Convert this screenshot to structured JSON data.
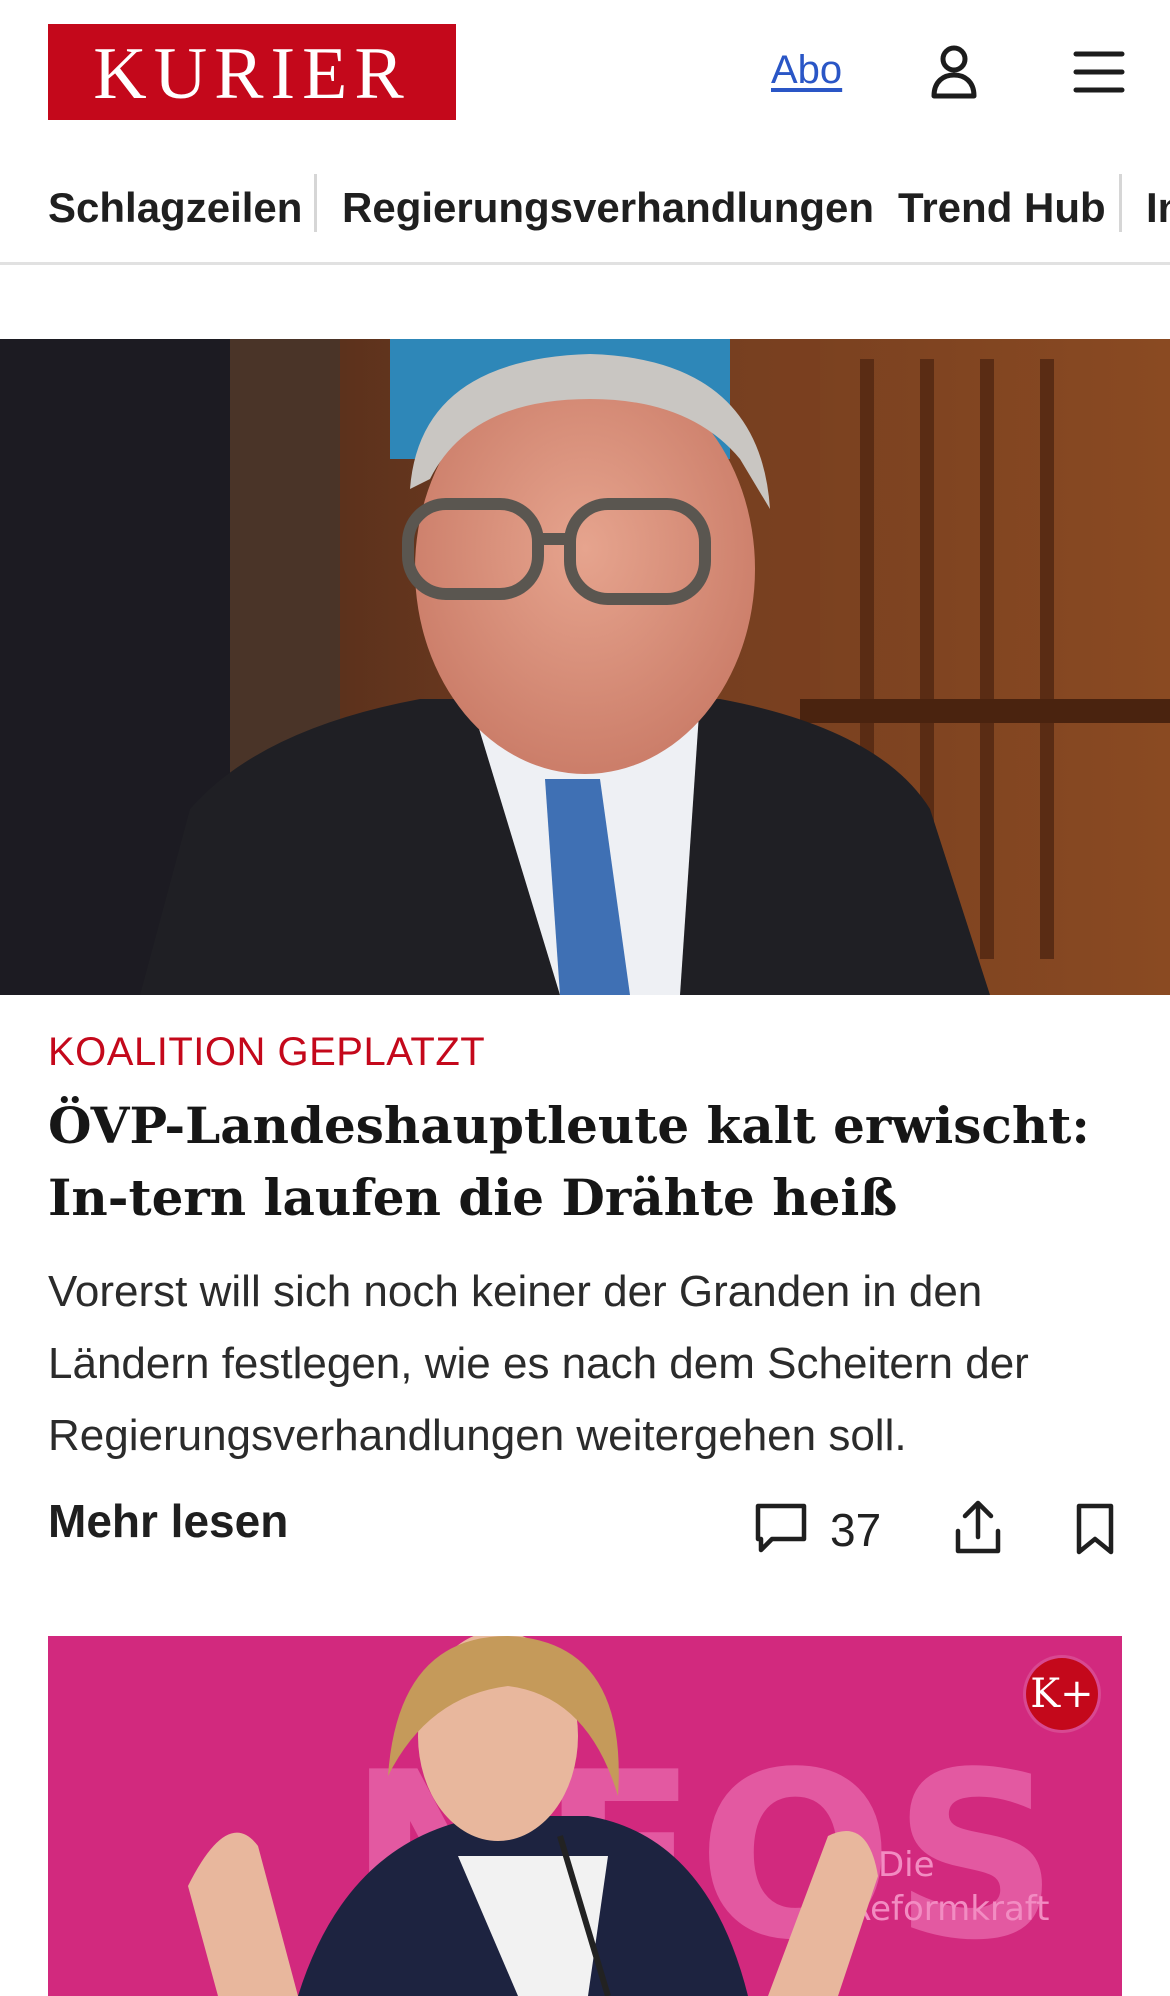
{
  "header": {
    "logo_text": "KURIER",
    "abo_label": "Abo",
    "account_icon": "user-icon",
    "menu_icon": "hamburger-menu-icon"
  },
  "nav": {
    "items": [
      "Schlagzeilen",
      "Regierungsverhandlungen",
      "Trend Hub",
      "In"
    ]
  },
  "article": {
    "kicker": "KOALITION GEPLATZT",
    "headline": "ÖVP-Landeshauptleute kalt erwischt: In-tern laufen die Drähte heiß",
    "teaser": "Vorerst will sich noch keiner der Granden in den Ländern festlegen, wie es nach dem Scheitern der Regierungsverhandlungen weitergehen soll.",
    "more_label": "Mehr lesen",
    "comment_count": "37",
    "comment_icon": "comment-icon",
    "share_icon": "share-icon",
    "bookmark_icon": "bookmark-icon"
  },
  "second_article": {
    "badge": "K+",
    "backdrop_text": "NEOS Die Reformkraft"
  },
  "colors": {
    "brand_red": "#c4081b",
    "link_blue": "#2a56c6",
    "second_image_pink": "#d2297e"
  }
}
